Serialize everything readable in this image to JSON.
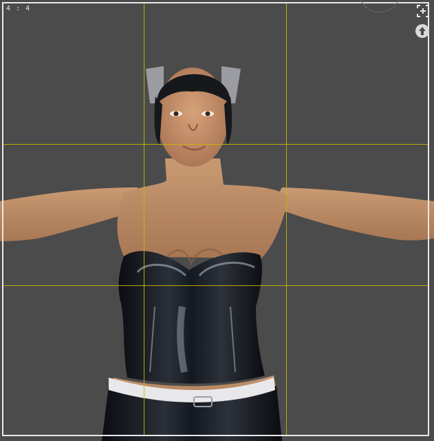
{
  "viewport": {
    "aspect_label": "4 : 4"
  },
  "icons": {
    "frame_selection": "frame-selection-icon",
    "camera_up": "arrow-up-circle-icon",
    "orientation_gizmo": "navigation-gizmo-icon"
  },
  "colors": {
    "background": "#4b4b4b",
    "guide_lines": "#c8b800",
    "frame_border": "#e9e9e9"
  }
}
